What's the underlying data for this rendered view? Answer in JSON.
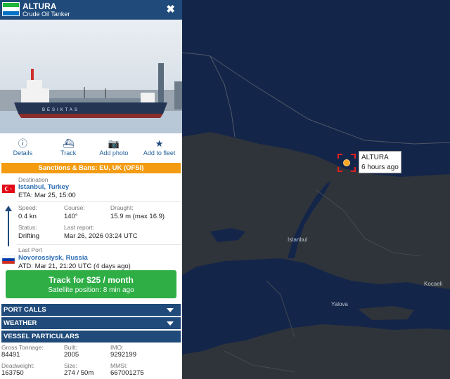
{
  "vessel": {
    "name": "ALTURA",
    "type": "Crude Oil Tanker",
    "close_icon": "close-icon",
    "flag_colors": [
      "#1eb53a",
      "#ffffff",
      "#0072c6"
    ]
  },
  "actions": [
    {
      "label": "Details",
      "icon": "info-icon"
    },
    {
      "label": "Track",
      "icon": "ship-icon"
    },
    {
      "label": "Add photo",
      "icon": "camera-icon"
    },
    {
      "label": "Add to fleet",
      "icon": "star-icon"
    }
  ],
  "sanctions": "Sanctions & Bans: EU, UK (OFSI)",
  "voyage": {
    "destination_label": "Destination",
    "destination": "Istanbul, Turkey",
    "eta": "ETA: Mar 25, 15:00",
    "speed_label": "Speed:",
    "speed": "0.4 kn",
    "course_label": "Course:",
    "course": "140°",
    "draught_label": "Draught:",
    "draught": "15.9 m (max 16.9)",
    "status_label": "Status:",
    "status": "Drifting",
    "last_report_label": "Last report:",
    "last_report": "Mar 26, 2026 03:24 UTC",
    "last_port_label": "Last Port",
    "last_port": "Novorossiysk, Russia",
    "atd": "ATD: Mar 21, 21:20 UTC",
    "atd_ago": "(4 days ago)"
  },
  "track": {
    "title": "Track for $25 / month",
    "subtitle": "Satellite position: 8 min ago"
  },
  "sections": {
    "port_calls": "PORT CALLS",
    "weather": "WEATHER",
    "particulars": "VESSEL PARTICULARS"
  },
  "particulars": {
    "gross_tonnage_label": "Gross Tonnage:",
    "gross_tonnage": "84491",
    "built_label": "Built:",
    "built": "2005",
    "imo_label": "IMO:",
    "imo": "9292199",
    "deadweight_label": "Deadweight:",
    "deadweight": "163750",
    "size_label": "Size:",
    "size": "274 / 50m",
    "mmsi_label": "MMSI:",
    "mmsi": "667001275"
  },
  "map": {
    "vessel_label": "ALTURA",
    "vessel_time": "6 hours ago",
    "cities": [
      "Istanbul",
      "Kocaeli",
      "Yalova"
    ]
  },
  "photo": {
    "hull_text": "BESIKTAS"
  }
}
